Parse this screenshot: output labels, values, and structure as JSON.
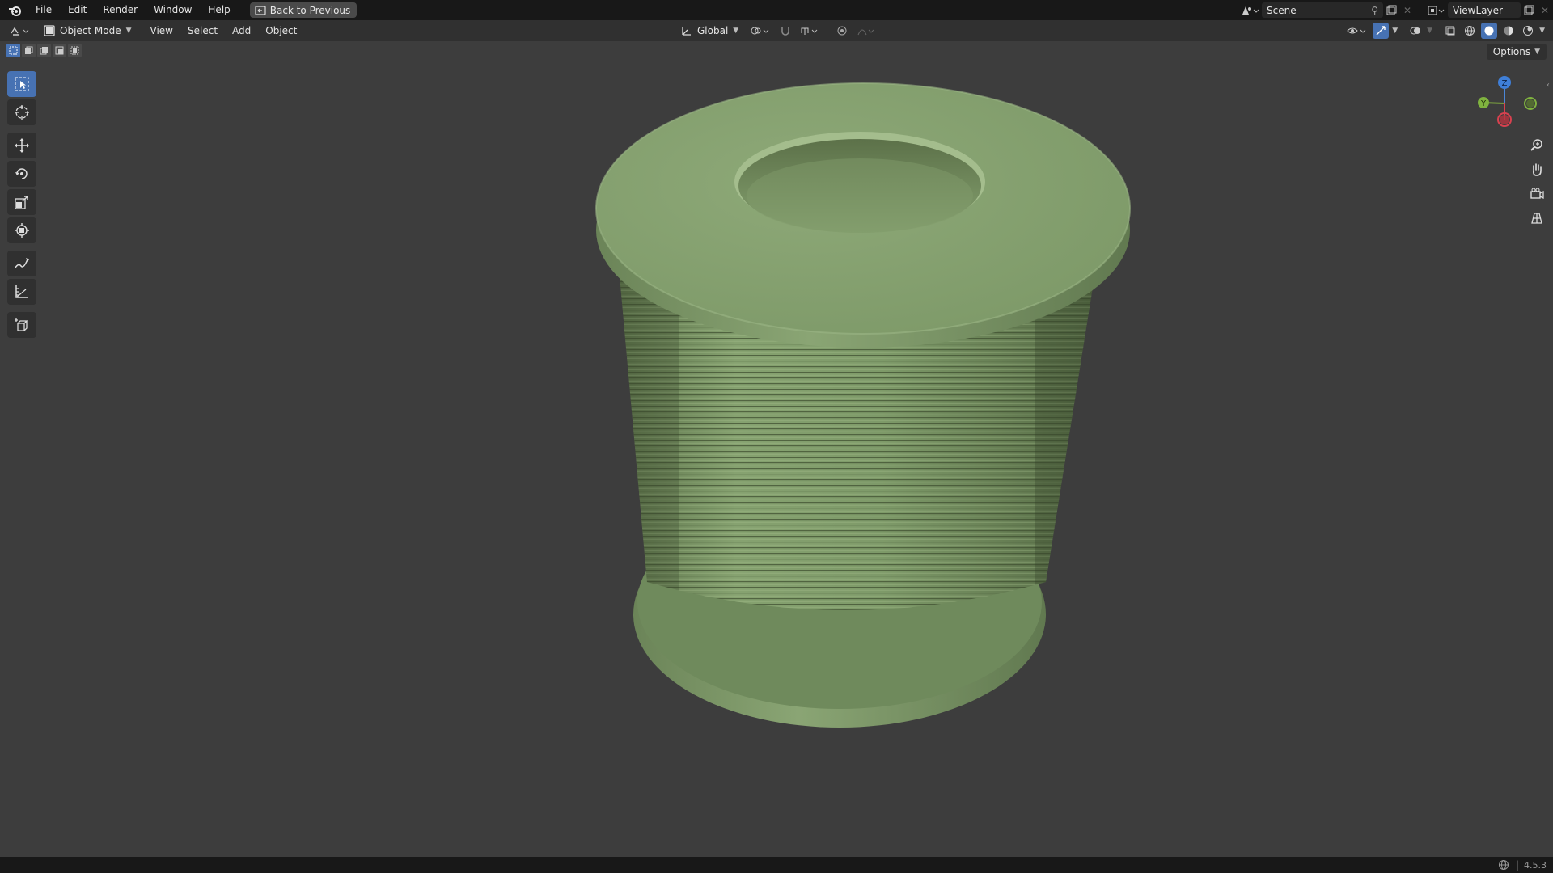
{
  "topbar": {
    "menu": [
      "File",
      "Edit",
      "Render",
      "Window",
      "Help"
    ],
    "back_button": "Back to Previous",
    "scene_name": "Scene",
    "view_layer": "ViewLayer"
  },
  "header": {
    "mode": "Object Mode",
    "menu": [
      "View",
      "Select",
      "Add",
      "Object"
    ],
    "transform_orientation": "Global",
    "options": "Options"
  },
  "toolbar": {
    "tools": [
      "select-box",
      "cursor",
      "move",
      "rotate",
      "scale",
      "transform",
      "annotate",
      "measure",
      "add-cube"
    ],
    "active_tool": "select-box"
  },
  "gizmo": {
    "axes": [
      "Z",
      "Y",
      "X"
    ]
  },
  "status": {
    "version": "4.5.3"
  },
  "colors": {
    "accent": "#4772b3",
    "object": "#7e9c6a",
    "background": "#3d3d3d"
  }
}
